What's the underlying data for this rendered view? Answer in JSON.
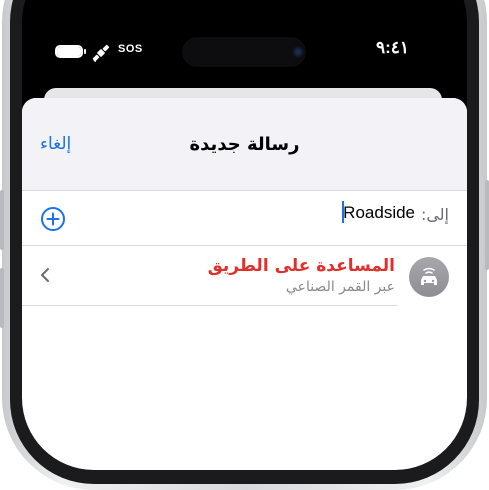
{
  "status_bar": {
    "time": "٩:٤١",
    "sos": "SOS"
  },
  "sheet": {
    "title": "رسالة جديدة",
    "cancel_label": "إلغاء"
  },
  "to_field": {
    "label": "إلى:",
    "value": "Roadside"
  },
  "suggestion": {
    "name": "المساعدة على الطريق",
    "subtitle": "عبر القمر الصناعي"
  },
  "colors": {
    "accent": "#1a73e8",
    "suggestion_name": "#e0302b"
  },
  "icons": [
    "battery-icon",
    "satellite-icon",
    "add-circle-icon",
    "car-icon",
    "chevron-left-icon"
  ]
}
